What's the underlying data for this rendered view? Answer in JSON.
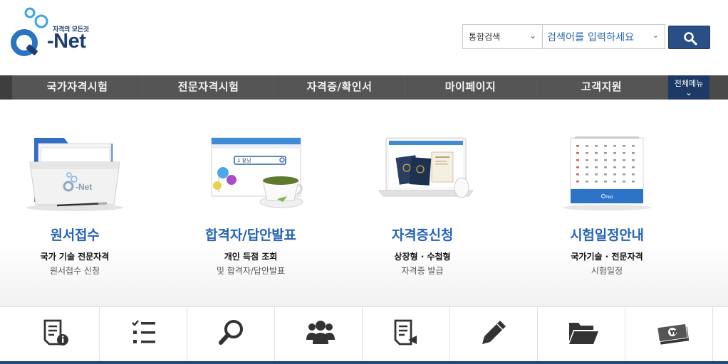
{
  "header": {
    "logo_tagline": "자격의 모든것",
    "logo_text": "-Net",
    "search_scope": "통합검색",
    "search_placeholder": "검색어를 입력하세요"
  },
  "nav": {
    "items": [
      "국가자격시험",
      "전문자격시험",
      "자격증/확인서",
      "마이페이지",
      "고객지원"
    ],
    "all_menu": "전체메뉴"
  },
  "cards": [
    {
      "title": "원서접수",
      "sub1": "국가 기술 전문자격",
      "sub2": "원서접수 신청",
      "icon": "folder-illustration"
    },
    {
      "title": "합격자/답안발표",
      "sub1": "개인 득점 조회",
      "sub2": "및 합격자/답안발표",
      "icon": "browser-teacup-illustration",
      "browser_text": "1 유닛"
    },
    {
      "title": "자격증신청",
      "sub1": "상장형 · 수첩형",
      "sub2": "자격증 발급",
      "icon": "laptop-passport-illustration"
    },
    {
      "title": "시험일정안내",
      "sub1": "국가기술 · 전문자격",
      "sub2": "시험일정",
      "icon": "calendar-illustration"
    }
  ],
  "quick_icons": [
    "document-info-icon",
    "checklist-icon",
    "search-icon",
    "users-icon",
    "document-return-icon",
    "pencil-icon",
    "folder-icon",
    "money-icon"
  ],
  "colors": {
    "brand_blue": "#2463b5",
    "nav_bg": "#4a4a4a",
    "dark_navy": "#1d3a66"
  }
}
